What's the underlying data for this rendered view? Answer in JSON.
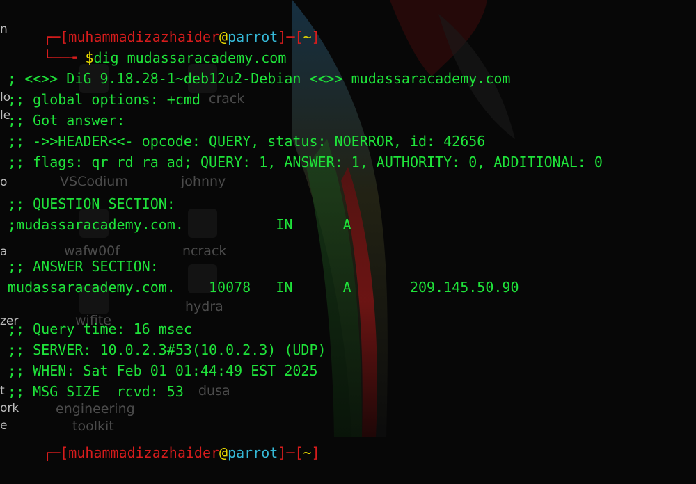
{
  "desktop": {
    "labels": [
      {
        "text": "VSCodium",
        "name": "desktop-label-vscodium"
      },
      {
        "text": "johnny",
        "name": "desktop-label-johnny"
      },
      {
        "text": "wafw00f",
        "name": "desktop-label-wafw00f"
      },
      {
        "text": "ncrack",
        "name": "desktop-label-ncrack"
      },
      {
        "text": "hydra",
        "name": "desktop-label-hydra"
      },
      {
        "text": "wifite",
        "name": "desktop-label-wifite"
      },
      {
        "text": "engineering",
        "name": "desktop-label-engineering"
      },
      {
        "text": "toolkit",
        "name": "desktop-label-toolkit"
      },
      {
        "text": "dusa",
        "name": "desktop-label-dusa"
      },
      {
        "text": "crack",
        "name": "desktop-label-crack"
      }
    ],
    "edge_fragments": [
      "n",
      "lo",
      "le",
      "o",
      "a",
      "zer",
      "t",
      "ork",
      "e"
    ]
  },
  "prompt": {
    "bracket_open": "┌─[",
    "user": "muhammadizazhaider",
    "at": "@",
    "host": "parrot",
    "mid": "]─[",
    "dir": "~",
    "bracket_close": "]",
    "second_lead": "└──╼ ",
    "dollar": "$",
    "command": "dig mudassaracademy.com"
  },
  "output": [
    "; <<>> DiG 9.18.28-1~deb12u2-Debian <<>> mudassaracademy.com",
    ";; global options: +cmd",
    ";; Got answer:",
    ";; ->>HEADER<<- opcode: QUERY, status: NOERROR, id: 42656",
    ";; flags: qr rd ra ad; QUERY: 1, ANSWER: 1, AUTHORITY: 0, ADDITIONAL: 0",
    "",
    ";; QUESTION SECTION:",
    ";mudassaracademy.com.           IN      A",
    "",
    ";; ANSWER SECTION:",
    "mudassaracademy.com.    10078   IN      A       209.145.50.90",
    "",
    ";; Query time: 16 msec",
    ";; SERVER: 10.0.2.3#53(10.0.2.3) (UDP)",
    ";; WHEN: Sat Feb 01 01:44:49 EST 2025",
    ";; MSG SIZE  rcvd: 53"
  ]
}
